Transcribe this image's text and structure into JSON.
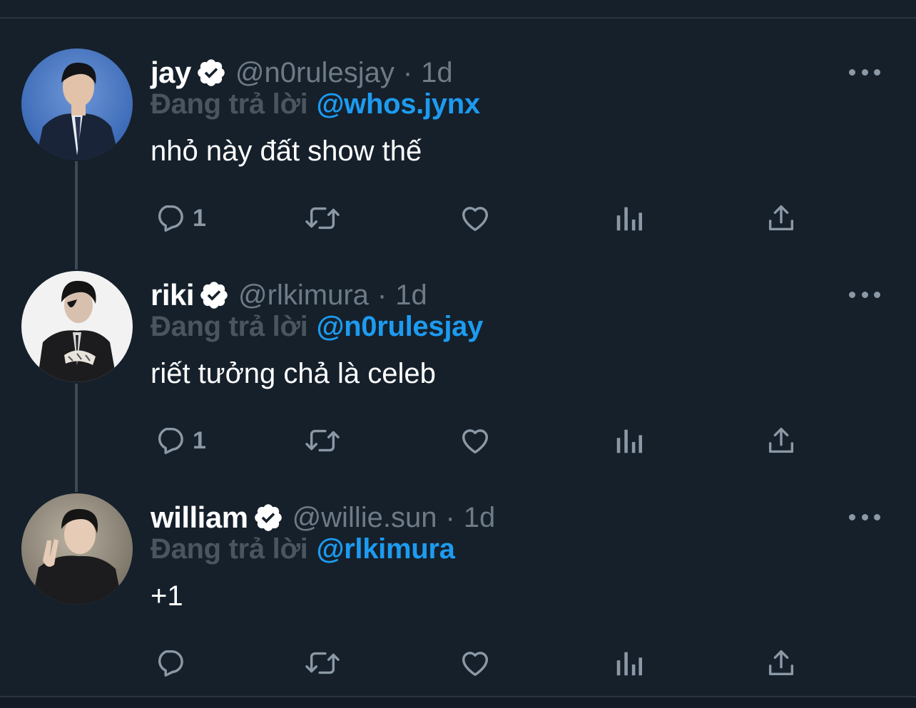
{
  "tweets": [
    {
      "name": "jay",
      "handle": "@n0rulesjay",
      "separator": "·",
      "time": "1d",
      "replying_prefix": "Đang trả lời",
      "replying_to": "@whos.jynx",
      "text": "nhỏ này đất show thế",
      "reply_count": "1",
      "verified": true
    },
    {
      "name": "riki",
      "handle": "@rlkimura",
      "separator": "·",
      "time": "1d",
      "replying_prefix": "Đang trả lời",
      "replying_to": "@n0rulesjay",
      "text": "riết tưởng chả là celeb",
      "reply_count": "1",
      "verified": true
    },
    {
      "name": "william",
      "handle": "@willie.sun",
      "separator": "·",
      "time": "1d",
      "replying_prefix": "Đang trả lời",
      "replying_to": "@rlkimura",
      "text": "+1",
      "reply_count": "",
      "verified": true
    }
  ],
  "icons": {
    "reply": "reply-icon",
    "retweet": "retweet-icon",
    "like": "heart-icon",
    "views": "analytics-icon",
    "share": "share-icon",
    "more": "more-icon",
    "verified": "verified-badge-icon"
  },
  "colors": {
    "background": "#15202b",
    "mention": "#1d9bf0",
    "muted": "#6e7b87",
    "icon": "#8b98a5",
    "text": "#ffffff"
  }
}
